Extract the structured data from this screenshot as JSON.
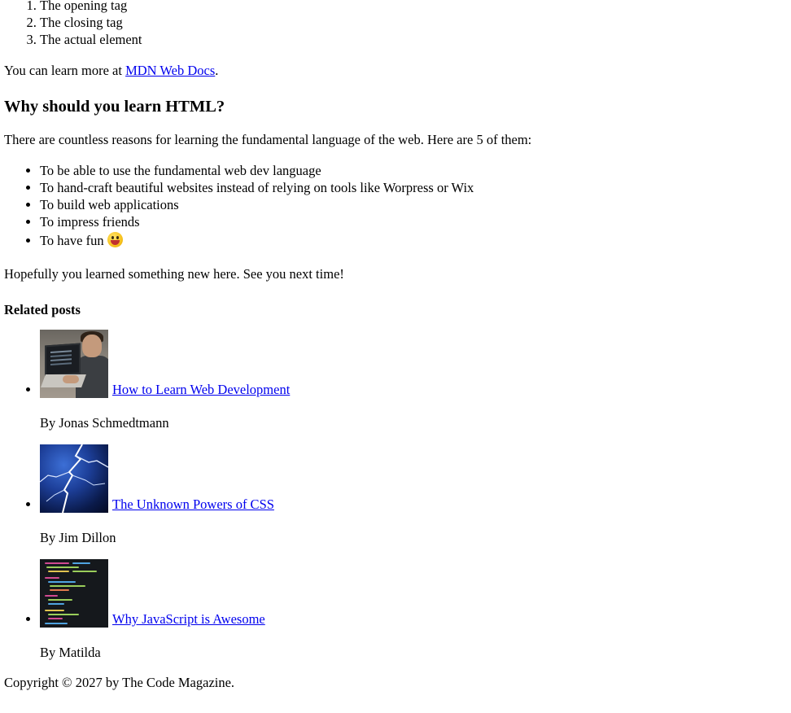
{
  "steps": [
    "The opening tag",
    "The closing tag",
    "The actual element"
  ],
  "learn_more": {
    "prefix": "You can learn more at ",
    "link_label": "MDN Web Docs",
    "suffix": "."
  },
  "why": {
    "heading": "Why should you learn HTML?",
    "intro": "There are countless reasons for learning the fundamental language of the web. Here are 5 of them:",
    "reasons": [
      "To be able to use the fundamental web dev language",
      "To hand-craft beautiful websites instead of relying on tools like Worpress or Wix",
      "To build web applications",
      "To impress friends",
      "To have fun"
    ],
    "fun_emoji_icon": "grinning-face-emoji"
  },
  "outro": "Hopefully you learned something new here. See you next time!",
  "related": {
    "heading": "Related posts",
    "posts": [
      {
        "title": "How to Learn Web Development",
        "author": "By Jonas Schmedtmann",
        "thumb_icon": "developer-laptop-image"
      },
      {
        "title": "The Unknown Powers of CSS",
        "author": "By Jim Dillon",
        "thumb_icon": "lightning-image"
      },
      {
        "title": "Why JavaScript is Awesome",
        "author": "By Matilda",
        "thumb_icon": "code-screen-image"
      }
    ]
  },
  "footer": "Copyright © 2027 by The Code Magazine.",
  "colors": {
    "link": "#0000ee",
    "text": "#000000",
    "background": "#ffffff"
  }
}
